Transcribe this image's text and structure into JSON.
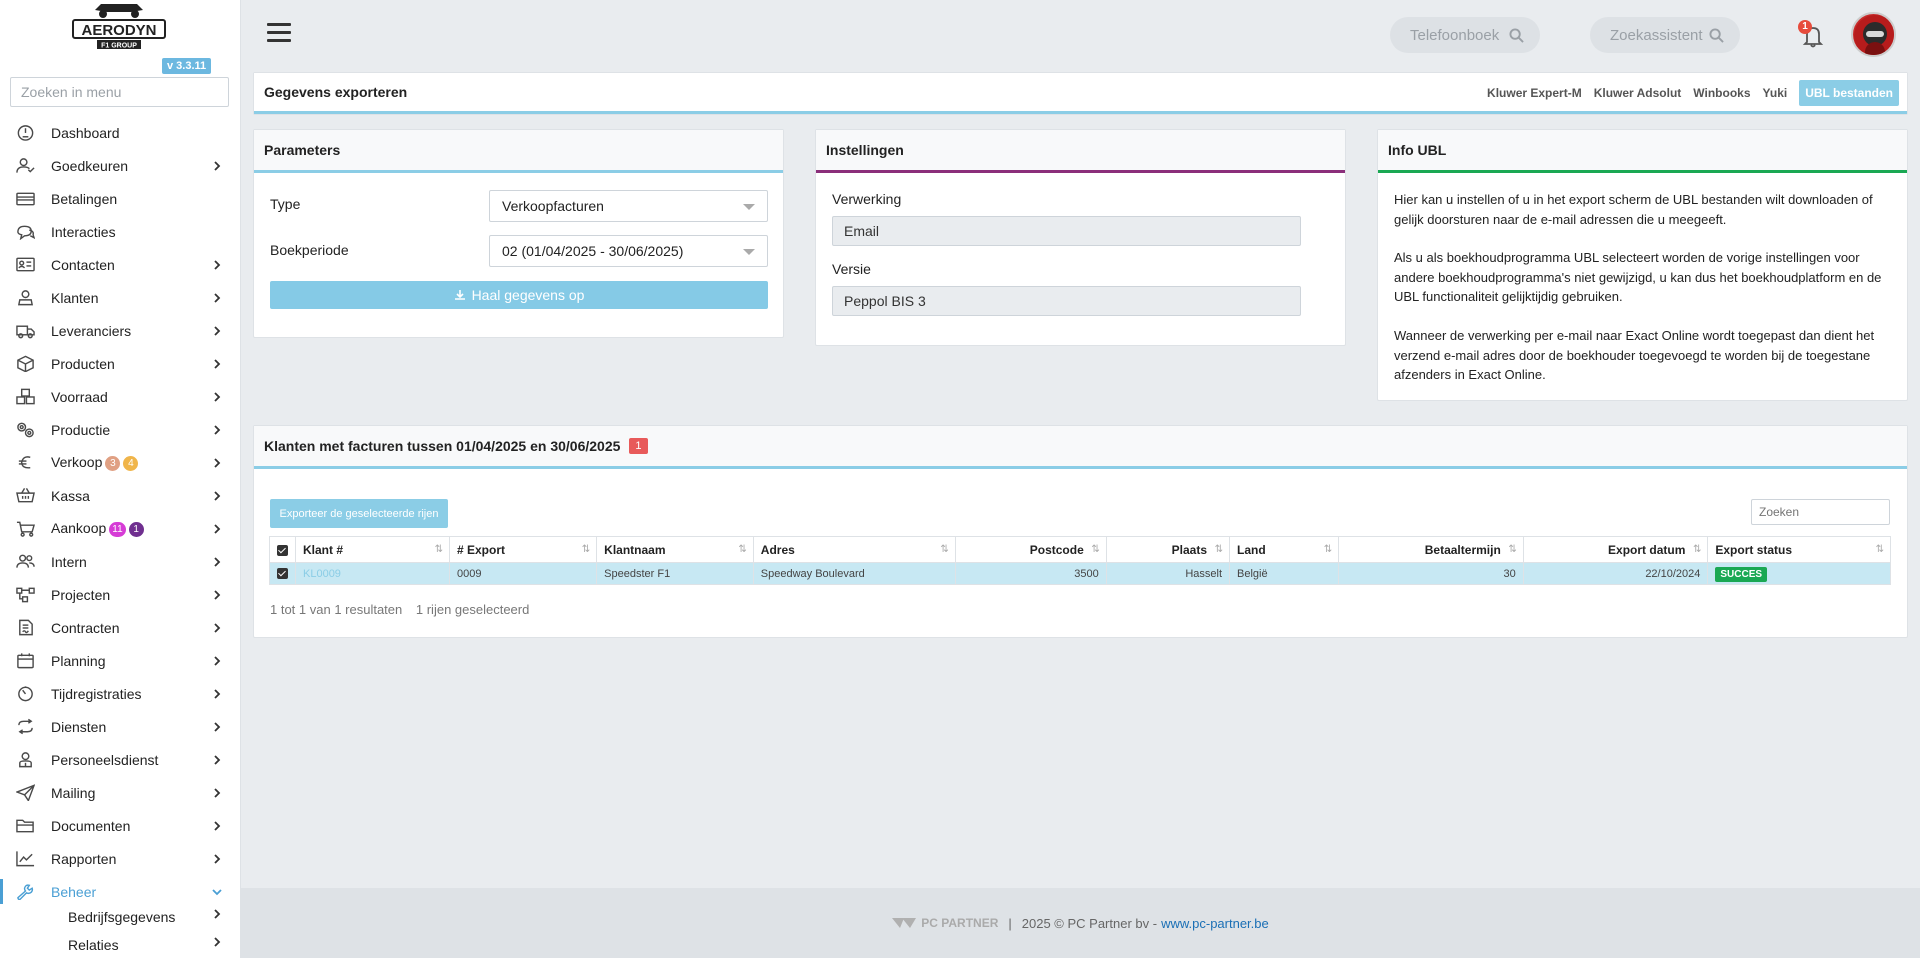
{
  "app": {
    "version": "v 3.3.11",
    "logo_text": "AERODYN",
    "logo_sub": "F1 GROUP"
  },
  "sidebar": {
    "search_placeholder": "Zoeken in menu",
    "items": [
      {
        "label": "Dashboard",
        "icon": "speedometer-icon",
        "chevron": false
      },
      {
        "label": "Goedkeuren",
        "icon": "user-check-icon",
        "chevron": true
      },
      {
        "label": "Betalingen",
        "icon": "credit-card-icon",
        "chevron": false
      },
      {
        "label": "Interacties",
        "icon": "chat-icon",
        "chevron": false
      },
      {
        "label": "Contacten",
        "icon": "contact-card-icon",
        "chevron": true
      },
      {
        "label": "Klanten",
        "icon": "customer-icon",
        "chevron": true
      },
      {
        "label": "Leveranciers",
        "icon": "truck-icon",
        "chevron": true
      },
      {
        "label": "Producten",
        "icon": "box-icon",
        "chevron": true
      },
      {
        "label": "Voorraad",
        "icon": "boxes-icon",
        "chevron": true
      },
      {
        "label": "Productie",
        "icon": "gears-icon",
        "chevron": true
      },
      {
        "label": "Verkoop",
        "icon": "euro-icon",
        "chevron": true,
        "badges": [
          {
            "text": "3",
            "color": "#e0a083"
          },
          {
            "text": "4",
            "color": "#f0b54a"
          }
        ]
      },
      {
        "label": "Kassa",
        "icon": "basket-icon",
        "chevron": true
      },
      {
        "label": "Aankoop",
        "icon": "cart-icon",
        "chevron": true,
        "badges": [
          {
            "text": "11",
            "color": "#d63cd6"
          },
          {
            "text": "1",
            "color": "#6f2f8f"
          }
        ]
      },
      {
        "label": "Intern",
        "icon": "users-icon",
        "chevron": true
      },
      {
        "label": "Projecten",
        "icon": "project-icon",
        "chevron": true
      },
      {
        "label": "Contracten",
        "icon": "contract-icon",
        "chevron": true
      },
      {
        "label": "Planning",
        "icon": "calendar-icon",
        "chevron": true
      },
      {
        "label": "Tijdregistraties",
        "icon": "timer-icon",
        "chevron": true
      },
      {
        "label": "Diensten",
        "icon": "repeat-icon",
        "chevron": true
      },
      {
        "label": "Personeelsdienst",
        "icon": "person-icon",
        "chevron": true
      },
      {
        "label": "Mailing",
        "icon": "paper-plane-icon",
        "chevron": true
      },
      {
        "label": "Documenten",
        "icon": "folder-icon",
        "chevron": true
      },
      {
        "label": "Rapporten",
        "icon": "chart-line-icon",
        "chevron": true
      },
      {
        "label": "Beheer",
        "icon": "wrench-icon",
        "chevron": true,
        "active": true
      }
    ],
    "subitems": [
      "Bedrijfsgegevens",
      "Relaties"
    ]
  },
  "topbar": {
    "phonebook_placeholder": "Telefoonboek",
    "assistant_placeholder": "Zoekassistent",
    "notification_count": "1"
  },
  "export": {
    "title": "Gegevens exporteren",
    "tabs": [
      "Kluwer Expert-M",
      "Kluwer Adsolut",
      "Winbooks",
      "Yuki",
      "UBL bestanden"
    ],
    "active_tab": "UBL bestanden"
  },
  "parameters": {
    "title": "Parameters",
    "type_label": "Type",
    "type_value": "Verkoopfacturen",
    "period_label": "Boekperiode",
    "period_value": "02 (01/04/2025 - 30/06/2025)",
    "fetch_button": "Haal gegevens op"
  },
  "settings": {
    "title": "Instellingen",
    "processing_label": "Verwerking",
    "processing_value": "Email",
    "version_label": "Versie",
    "version_value": "Peppol BIS 3"
  },
  "info": {
    "title": "Info UBL",
    "p1": "Hier kan u instellen of u in het export scherm de UBL bestanden wilt downloaden of gelijk doorsturen naar de e-mail adressen die u meegeeft.",
    "p2": "Als u als boekhoudprogramma UBL selecteert worden de vorige instellingen voor andere boekhoudprogramma's niet gewijzigd, u kan dus het boekhoudplatform en de UBL functionaliteit gelijktijdig gebruiken.",
    "p3": "Wanneer de verwerking per e-mail naar Exact Online wordt toegepast dan dient het verzend e-mail adres door de boekhouder toegevoegd te worden bij de toegestane afzenders in Exact Online."
  },
  "customers": {
    "title": "Klanten met facturen tussen 01/04/2025 en 30/06/2025",
    "count": "1",
    "export_button": "Exporteer de geselecteerde rijen",
    "search_placeholder": "Zoeken",
    "columns": [
      "Klant #",
      "# Export",
      "Klantnaam",
      "Adres",
      "Postcode",
      "Plaats",
      "Land",
      "Betaaltermijn",
      "Export datum",
      "Export status"
    ],
    "rows": [
      {
        "klant": "KL0009",
        "export": "0009",
        "naam": "Speedster F1",
        "adres": "Speedway Boulevard",
        "postcode": "3500",
        "plaats": "Hasselt",
        "land": "België",
        "termijn": "30",
        "datum": "22/10/2024",
        "status": "SUCCES"
      }
    ],
    "summary": "1 tot 1 van 1 resultaten",
    "selected": "1 rijen geselecteerd"
  },
  "footer": {
    "brand": "PC PARTNER",
    "copyright": "2025 © PC Partner bv -",
    "link": "www.pc-partner.be"
  },
  "colors": {
    "accent": "#4a9fd4",
    "params_line": "#8bcde6",
    "settings_line": "#8b2f7a",
    "info_line": "#1aa853",
    "success": "#1aa853"
  }
}
